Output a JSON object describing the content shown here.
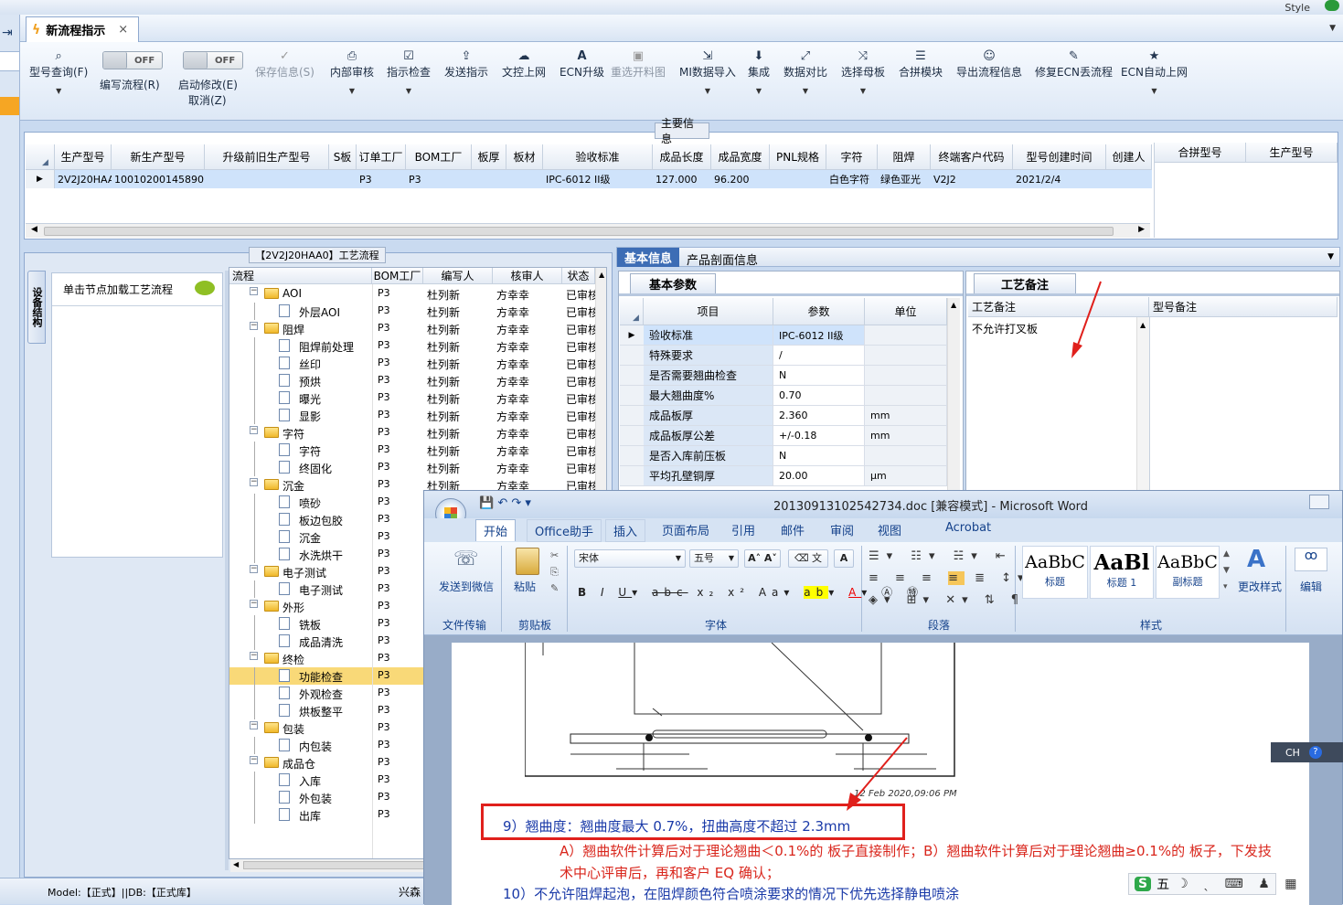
{
  "app": {
    "style_label": "Style"
  },
  "tab": {
    "title": "新流程指示",
    "close": "×"
  },
  "toolbar": {
    "items": [
      {
        "label": "型号查询(F)",
        "icon": "search-icon"
      },
      {
        "label": "编写流程(R)",
        "toggle": "OFF"
      },
      {
        "label": "启动修改(E)",
        "sublabel": "取消(Z)",
        "toggle": "OFF"
      },
      {
        "label": "保存信息(S)",
        "icon": "check-icon",
        "disabled": true
      },
      {
        "label": "内部审核",
        "icon": "printer-icon"
      },
      {
        "label": "指示检查",
        "icon": "checkbox-icon"
      },
      {
        "label": "发送指示",
        "icon": "upload-icon"
      },
      {
        "label": "文控上网",
        "icon": "cloud-upload-icon"
      },
      {
        "label": "ECN升级",
        "icon": "font-icon"
      },
      {
        "label": "重选开料图",
        "icon": "image-icon",
        "disabled": true
      },
      {
        "label": "MI数据导入",
        "icon": "import-icon"
      },
      {
        "label": "集成",
        "icon": "download-icon"
      },
      {
        "label": "数据对比",
        "icon": "compare-icon"
      },
      {
        "label": "选择母板",
        "icon": "shuffle-icon"
      },
      {
        "label": "合拼模块",
        "icon": "list-icon"
      },
      {
        "label": "导出流程信息",
        "icon": "smiley-icon"
      },
      {
        "label": "修复ECN丢流程",
        "icon": "wrench-icon"
      },
      {
        "label": "ECN自动上网",
        "icon": "star-icon"
      }
    ]
  },
  "main_info": {
    "title": "主要信息",
    "columns": [
      "生产型号",
      "新生产型号",
      "升级前旧生产型号",
      "S板",
      "订单工厂",
      "BOM工厂",
      "板厚",
      "板材",
      "验收标准",
      "成品长度",
      "成品宽度",
      "PNL规格",
      "字符",
      "阻焊",
      "终端客户代码",
      "型号创建时间",
      "创建人"
    ],
    "row": [
      "2V2J20HAA0",
      "10010200145890",
      "",
      "",
      "P3",
      "P3",
      "",
      "",
      "IPC-6012 II级",
      "127.000",
      "96.200",
      "",
      "白色字符",
      "绿色亚光",
      "V2J2",
      "2021/2/4",
      ""
    ],
    "side_columns": [
      "合拼型号",
      "生产型号"
    ]
  },
  "flow": {
    "title": "【2V2J20HAA0】工艺流程",
    "side_tab": "设备结构",
    "hint": "单击节点加载工艺流程",
    "columns": [
      "流程",
      "BOM工厂",
      "编写人",
      "核审人",
      "状态"
    ],
    "rows": [
      {
        "name": "AOI",
        "level": 0,
        "bom": "P3",
        "writer": "杜列新",
        "reviewer": "方幸幸",
        "status": "已审核"
      },
      {
        "name": "外层AOI",
        "level": 1,
        "bom": "P3",
        "writer": "杜列新",
        "reviewer": "方幸幸",
        "status": "已审核"
      },
      {
        "name": "阻焊",
        "level": 0,
        "bom": "P3",
        "writer": "杜列新",
        "reviewer": "方幸幸",
        "status": "已审核"
      },
      {
        "name": "阻焊前处理",
        "level": 1,
        "bom": "P3",
        "writer": "杜列新",
        "reviewer": "方幸幸",
        "status": "已审核"
      },
      {
        "name": "丝印",
        "level": 1,
        "bom": "P3",
        "writer": "杜列新",
        "reviewer": "方幸幸",
        "status": "已审核"
      },
      {
        "name": "预烘",
        "level": 1,
        "bom": "P3",
        "writer": "杜列新",
        "reviewer": "方幸幸",
        "status": "已审核"
      },
      {
        "name": "曝光",
        "level": 1,
        "bom": "P3",
        "writer": "杜列新",
        "reviewer": "方幸幸",
        "status": "已审核"
      },
      {
        "name": "显影",
        "level": 1,
        "bom": "P3",
        "writer": "杜列新",
        "reviewer": "方幸幸",
        "status": "已审核"
      },
      {
        "name": "字符",
        "level": 0,
        "bom": "P3",
        "writer": "杜列新",
        "reviewer": "方幸幸",
        "status": "已审核"
      },
      {
        "name": "字符",
        "level": 1,
        "bom": "P3",
        "writer": "杜列新",
        "reviewer": "方幸幸",
        "status": "已审核"
      },
      {
        "name": "终固化",
        "level": 1,
        "bom": "P3",
        "writer": "杜列新",
        "reviewer": "方幸幸",
        "status": "已审核"
      },
      {
        "name": "沉金",
        "level": 0,
        "bom": "P3",
        "writer": "杜列新",
        "reviewer": "方幸幸",
        "status": "已审核"
      },
      {
        "name": "喷砂",
        "level": 1,
        "bom": "P3",
        "writer": "",
        "reviewer": "",
        "status": ""
      },
      {
        "name": "板边包胶",
        "level": 1,
        "bom": "P3",
        "writer": "",
        "reviewer": "",
        "status": ""
      },
      {
        "name": "沉金",
        "level": 1,
        "bom": "P3",
        "writer": "",
        "reviewer": "",
        "status": ""
      },
      {
        "name": "水洗烘干",
        "level": 1,
        "bom": "P3",
        "writer": "",
        "reviewer": "",
        "status": ""
      },
      {
        "name": "电子测试",
        "level": 0,
        "bom": "P3",
        "writer": "",
        "reviewer": "",
        "status": ""
      },
      {
        "name": "电子测试",
        "level": 1,
        "bom": "P3",
        "writer": "",
        "reviewer": "",
        "status": ""
      },
      {
        "name": "外形",
        "level": 0,
        "bom": "P3",
        "writer": "",
        "reviewer": "",
        "status": ""
      },
      {
        "name": "铣板",
        "level": 1,
        "bom": "P3",
        "writer": "",
        "reviewer": "",
        "status": ""
      },
      {
        "name": "成品清洗",
        "level": 1,
        "bom": "P3",
        "writer": "",
        "reviewer": "",
        "status": ""
      },
      {
        "name": "终检",
        "level": 0,
        "bom": "P3",
        "writer": "",
        "reviewer": "",
        "status": ""
      },
      {
        "name": "功能检查",
        "level": 1,
        "bom": "P3",
        "writer": "",
        "reviewer": "",
        "status": "",
        "selected": true
      },
      {
        "name": "外观检查",
        "level": 1,
        "bom": "P3",
        "writer": "",
        "reviewer": "",
        "status": ""
      },
      {
        "name": "烘板整平",
        "level": 1,
        "bom": "P3",
        "writer": "",
        "reviewer": "",
        "status": ""
      },
      {
        "name": "包装",
        "level": 0,
        "bom": "P3",
        "writer": "",
        "reviewer": "",
        "status": ""
      },
      {
        "name": "内包装",
        "level": 1,
        "bom": "P3",
        "writer": "",
        "reviewer": "",
        "status": ""
      },
      {
        "name": "成品仓",
        "level": 0,
        "bom": "P3",
        "writer": "",
        "reviewer": "",
        "status": ""
      },
      {
        "name": "入库",
        "level": 1,
        "bom": "P3",
        "writer": "",
        "reviewer": "",
        "status": ""
      },
      {
        "name": "外包装",
        "level": 1,
        "bom": "P3",
        "writer": "",
        "reviewer": "",
        "status": ""
      },
      {
        "name": "出库",
        "level": 1,
        "bom": "P3",
        "writer": "",
        "reviewer": "",
        "status": ""
      }
    ]
  },
  "details": {
    "tabs": [
      "基本信息",
      "产品剖面信息"
    ],
    "sub_tab": "基本参数",
    "columns": [
      "项目",
      "参数",
      "单位"
    ],
    "rows": [
      [
        "验收标准",
        "IPC-6012 II级",
        ""
      ],
      [
        "特殊要求",
        "/",
        ""
      ],
      [
        "是否需要翘曲检查",
        "N",
        ""
      ],
      [
        "最大翘曲度%",
        "0.70",
        ""
      ],
      [
        "成品板厚",
        "2.360",
        "mm"
      ],
      [
        "成品板厚公差",
        "+/-0.18",
        "mm"
      ],
      [
        "是否入库前压板",
        "N",
        ""
      ],
      [
        "平均孔壁铜厚",
        "20.00",
        "μm"
      ]
    ]
  },
  "remarks": {
    "tab": "工艺备注",
    "columns": [
      "工艺备注",
      "型号备注"
    ],
    "text": "不允许打叉板"
  },
  "status_bar": {
    "text": "Model:【正式】||DB:【正式库】",
    "right": "兴森"
  },
  "word": {
    "title": "20130913102542734.doc [兼容模式] - Microsoft Word",
    "tabs": [
      "开始",
      "Office助手",
      "插入",
      "页面布局",
      "引用",
      "邮件",
      "审阅",
      "视图",
      "Acrobat"
    ],
    "font": "宋体",
    "size": "五号",
    "groups": [
      "文件传输",
      "剪贴板",
      "字体",
      "段落",
      "样式"
    ],
    "send_wechat": "发送到微信",
    "paste": "粘贴",
    "change_style": "更改样式",
    "edit": "编辑",
    "styles": [
      {
        "preview": "AaBbC",
        "name": "标题"
      },
      {
        "preview": "AaBl",
        "name": "标题 1"
      },
      {
        "preview": "AaBbC",
        "name": "副标题"
      }
    ],
    "drawing_label": "12 Feb 2020,09:06 PM",
    "line9": "9）翘曲度：翘曲度最大 0.7%，扭曲高度不超过 2.3mm",
    "line_ab": "A）翘曲软件计算后对于理论翘曲＜0.1%的 板子直接制作；B）翘曲软件计算后对于理论翘曲≥0.1%的 板子，下发技术中心评审后，再和客户 EQ 确认；",
    "line10": "10）不允许阻焊起泡，在阻焊颜色符合喷涂要求的情况下优先选择静电喷涂",
    "ime": "五",
    "lang": "CH"
  }
}
